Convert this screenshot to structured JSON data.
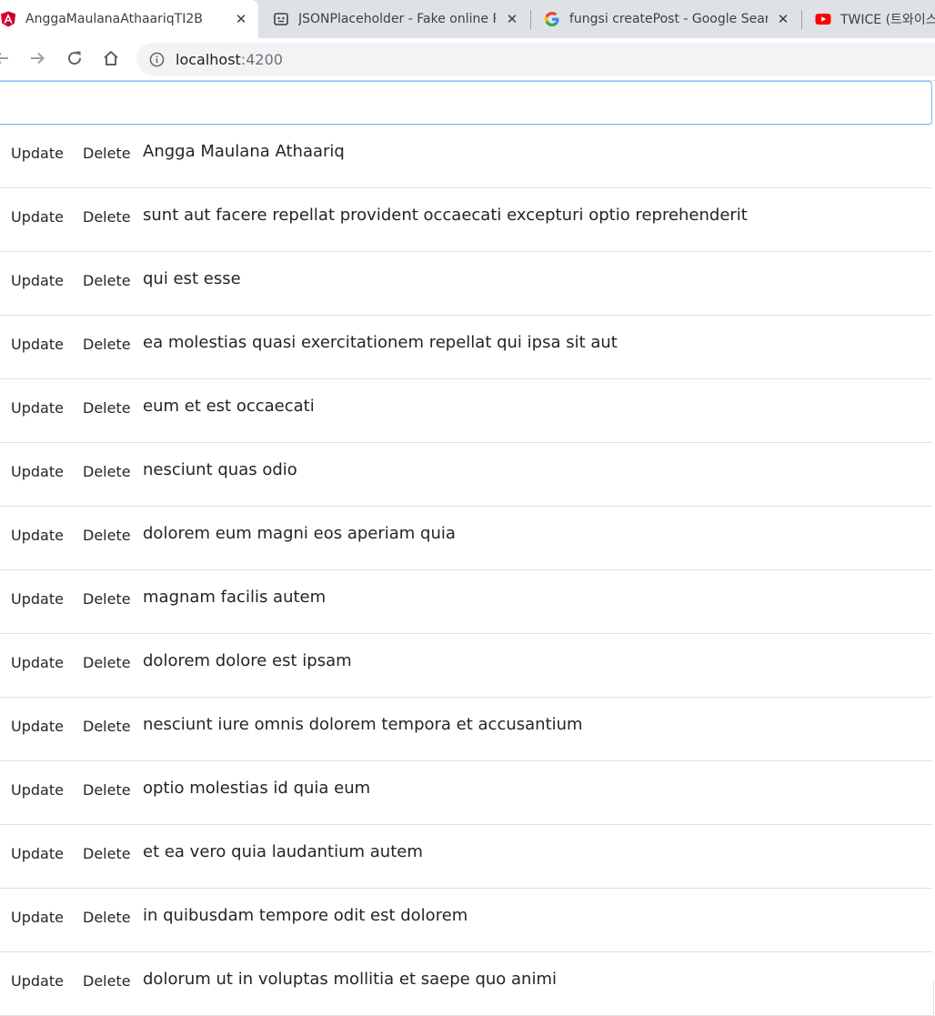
{
  "browser": {
    "tabs": [
      {
        "title": "AnggaMaulanaAthaariqTI2B",
        "icon": "angular-icon",
        "active": true
      },
      {
        "title": "JSONPlaceholder - Fake online REST API",
        "icon": "jsonplaceholder-icon",
        "active": false
      },
      {
        "title": "fungsi createPost - Google Search",
        "icon": "google-icon",
        "active": false
      },
      {
        "title": "TWICE (트와이스",
        "icon": "youtube-icon",
        "active": false
      }
    ],
    "address": {
      "host": "localhost",
      "port": ":4200"
    }
  },
  "search": {
    "value": "",
    "placeholder": ""
  },
  "buttons": {
    "update": "Update",
    "delete": "Delete"
  },
  "posts": [
    "Angga Maulana Athaariq",
    "sunt aut facere repellat provident occaecati excepturi optio reprehenderit",
    "qui est esse",
    "ea molestias quasi exercitationem repellat qui ipsa sit aut",
    "eum et est occaecati",
    "nesciunt quas odio",
    "dolorem eum magni eos aperiam quia",
    "magnam facilis autem",
    "dolorem dolore est ipsam",
    "nesciunt iure omnis dolorem tempora et accusantium",
    "optio molestias id quia eum",
    "et ea vero quia laudantium autem",
    "in quibusdam tempore odit est dolorem",
    "dolorum ut in voluptas mollitia et saepe quo animi"
  ],
  "colors": {
    "tabstrip": "#dee1e6",
    "input_focus": "#80bdff",
    "angular": "#dd0031",
    "youtube": "#ff0000"
  }
}
